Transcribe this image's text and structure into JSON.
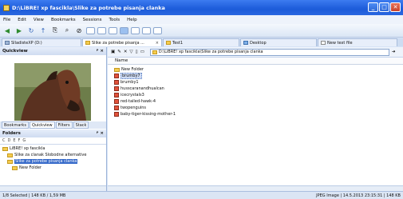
{
  "window": {
    "title": "D:\\LiBRE! xp fascikla\\Slike za potrebe pisanja clanka"
  },
  "menu": [
    "File",
    "Edit",
    "View",
    "Bookmarks",
    "Sessions",
    "Tools",
    "Help"
  ],
  "tabs": [
    {
      "label": "SlladisteXP (D:)"
    },
    {
      "label": "Slike za potrebe pisanja ..."
    },
    {
      "label": "Test1"
    },
    {
      "label": "Desktop"
    },
    {
      "label": "New text file"
    }
  ],
  "quickview": {
    "title": "Quickview",
    "subtabs": [
      "Bookmarks",
      "Quickview",
      "Filters",
      "Stack"
    ],
    "active_subtab": "Quickview"
  },
  "folders": {
    "title": "Folders",
    "drives": [
      "C",
      "D",
      "E",
      "F",
      "G"
    ],
    "tree": [
      {
        "label": "LiBRE! xp fascikla",
        "selected": false
      },
      {
        "label": "Slike za clanak Slobodne alternative",
        "selected": false
      },
      {
        "label": "Slike za potrebe pisanja clanka",
        "selected": true
      },
      {
        "label": "New Folder",
        "selected": false
      }
    ]
  },
  "address": {
    "path": "D:\\LiBRE! xp fascikla\\Slike za potrebe pisanja clanka"
  },
  "list": {
    "column": "Name",
    "items": [
      {
        "name": "New Folder",
        "type": "folder",
        "selected": false
      },
      {
        "name": "brumby7",
        "type": "image",
        "selected": true
      },
      {
        "name": "brumby1",
        "type": "image",
        "selected": false
      },
      {
        "name": "husscaranandhualcan",
        "type": "image",
        "selected": false
      },
      {
        "name": "icecrystals3",
        "type": "image",
        "selected": false
      },
      {
        "name": "red-tailed-hawk-4",
        "type": "image",
        "selected": false
      },
      {
        "name": "twopenguins",
        "type": "image",
        "selected": false
      },
      {
        "name": "baby-tiger-kissing-mother-1",
        "type": "image",
        "selected": false
      }
    ]
  },
  "status": {
    "left": "1/8 Selected | 148 KB / 1,59 MB",
    "right": "JPEG Image | 14.5.2013 23:15:31 | 148 KB"
  },
  "colors": {
    "title_blue": "#1c5bd9",
    "selection_blue": "#3569c9"
  }
}
